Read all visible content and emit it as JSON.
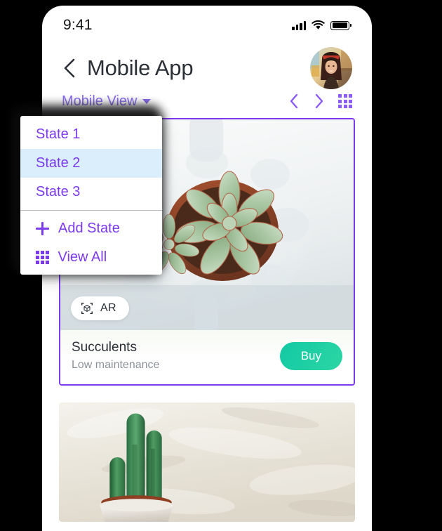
{
  "status_bar": {
    "time": "9:41",
    "signal_icon": "cellular-signal-icon",
    "wifi_icon": "wifi-icon",
    "battery_icon": "battery-full-icon"
  },
  "header": {
    "back_icon": "back-chevron-icon",
    "title": "Mobile App",
    "avatar_icon": "user-avatar"
  },
  "toolbar": {
    "view_label": "Mobile View",
    "caret_icon": "caret-down-icon",
    "prev_icon": "chevron-left-icon",
    "next_icon": "chevron-right-icon",
    "grid_icon": "grid-view-icon"
  },
  "dropdown": {
    "items": [
      {
        "label": "State 1",
        "selected": false
      },
      {
        "label": "State 2",
        "selected": true
      },
      {
        "label": "State 3",
        "selected": false
      }
    ],
    "actions": [
      {
        "label": "Add State",
        "icon": "plus-icon"
      },
      {
        "label": "View All",
        "icon": "grid-icon"
      }
    ]
  },
  "cards": [
    {
      "image": "succulent-plant-photo",
      "ar_badge": {
        "label": "AR",
        "icon": "ar-cube-icon"
      },
      "title": "Succulents",
      "subtitle": "Low maintenance",
      "button_label": "Buy",
      "selected": true
    },
    {
      "image": "cactus-plant-photo"
    }
  ],
  "colors": {
    "accent_purple": "#7c3aed",
    "muted_purple": "#8b6df0",
    "selected_row": "#daeefb",
    "buy_teal": "#12c9a4",
    "title_dark": "#2b2f36",
    "subtitle_gray": "#8d9299"
  }
}
